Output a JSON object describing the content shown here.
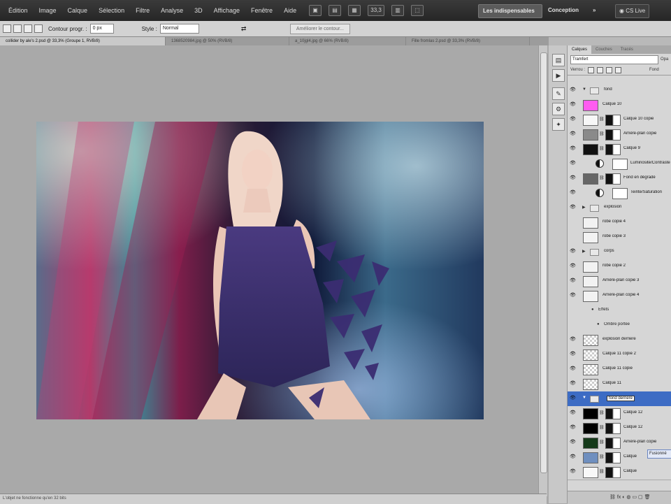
{
  "menu": {
    "items": [
      "Édition",
      "Image",
      "Calque",
      "Sélection",
      "Filtre",
      "Analyse",
      "3D",
      "Affichage",
      "Fenêtre",
      "Aide"
    ],
    "zoom": "33,3",
    "workspace_active": "Les indispensables",
    "workspace_design": "Conception",
    "more": "»",
    "cslive": "CS Live"
  },
  "options": {
    "contour_label": "Contour progr. :",
    "contour_value": "0 px",
    "style_label": "Style :",
    "style_value": "Normal",
    "refine_label": "Améliorer le contour..."
  },
  "tabs": [
    {
      "label": "collider by ale's 2.psd @ 33,3% (Groupe 1, RVB/8)",
      "active": true
    },
    {
      "label": "1368520984.jpg @ 50% (RVB/8)",
      "active": false
    },
    {
      "label": "a_10jgl4.jpg @ 66% (RVB/8)",
      "active": false
    },
    {
      "label": "Fille fromlas 2.psd @ 33,3% (RVB/8)",
      "active": false
    }
  ],
  "status": {
    "text": "L'objet ne fonctionne qu'en 32 bits"
  },
  "layers_panel": {
    "tabs": [
      "Calques",
      "Couches",
      "Tracés"
    ],
    "blend_mode": "Tramfert",
    "opacity_label": "Opa",
    "lock_label": "Verrou :",
    "fill_label": "Fond",
    "rows": [
      {
        "name": "fond",
        "kind": "group",
        "eye": true,
        "expanded": true
      },
      {
        "name": "Calque 10",
        "kind": "layer",
        "eye": true,
        "thumb": "#ff5cf0"
      },
      {
        "name": "Calque 10 copie",
        "kind": "masked",
        "eye": true,
        "thumb": "#f7f7f7"
      },
      {
        "name": "Arrière-plan copie",
        "kind": "masked",
        "eye": true,
        "thumb": "#8a8a8a"
      },
      {
        "name": "Calque 9",
        "kind": "masked",
        "eye": true,
        "thumb": "#111111"
      },
      {
        "name": "Luminosité/Contraste",
        "kind": "adjust",
        "eye": true
      },
      {
        "name": "Fond en dégradé",
        "kind": "masked",
        "eye": true,
        "thumb": "#666666"
      },
      {
        "name": "Teinte/Saturation",
        "kind": "adjust",
        "eye": true
      },
      {
        "name": "explosion",
        "kind": "group",
        "eye": true,
        "expanded": false
      },
      {
        "name": "robe copie 4",
        "kind": "layer",
        "eye": false,
        "thumb": "#f2f2f2"
      },
      {
        "name": "robe copie 3",
        "kind": "layer",
        "eye": false,
        "thumb": "#f2f2f2"
      },
      {
        "name": "corps",
        "kind": "group",
        "eye": true,
        "expanded": false
      },
      {
        "name": "robe copie 2",
        "kind": "layer",
        "eye": true,
        "thumb": "#f2f2f2"
      },
      {
        "name": "Arrière-plan copie 3",
        "kind": "layer",
        "eye": true,
        "thumb": "#f2f2f2"
      },
      {
        "name": "Arrière-plan copie 4",
        "kind": "layer",
        "eye": true,
        "thumb": "#f2f2f2"
      },
      {
        "name": "Effets",
        "kind": "effect",
        "eye": false
      },
      {
        "name": "Ombre portée",
        "kind": "effect2",
        "eye": false
      },
      {
        "name": "explosion derriere",
        "kind": "layer",
        "eye": true,
        "thumb": "checker"
      },
      {
        "name": "Calque 11 copie 2",
        "kind": "layer",
        "eye": true,
        "thumb": "checker"
      },
      {
        "name": "Calque 11 copie",
        "kind": "layer",
        "eye": true,
        "thumb": "checker"
      },
      {
        "name": "Calque 11",
        "kind": "layer",
        "eye": true,
        "thumb": "checker"
      },
      {
        "name": "fond derriere",
        "kind": "selected",
        "eye": true
      },
      {
        "name": "Calque 12",
        "kind": "masked",
        "eye": true,
        "thumb": "#000000"
      },
      {
        "name": "Calque 12",
        "kind": "masked",
        "eye": true,
        "thumb": "#000000"
      },
      {
        "name": "Arrière-plan copie",
        "kind": "masked",
        "eye": true,
        "thumb": "#153a1a"
      },
      {
        "name": "Calque",
        "kind": "masked",
        "eye": true,
        "thumb": "#6f8fbf"
      },
      {
        "name": "Calque",
        "kind": "masked",
        "eye": true,
        "thumb": "#f8f8f8"
      }
    ],
    "tooltip": "Fusionné"
  },
  "colors": {
    "menubar": "#2e2e2e",
    "selection": "#3d6cc4",
    "panel": "#d6d6d6",
    "pasteboard": "#a9a9a9"
  }
}
